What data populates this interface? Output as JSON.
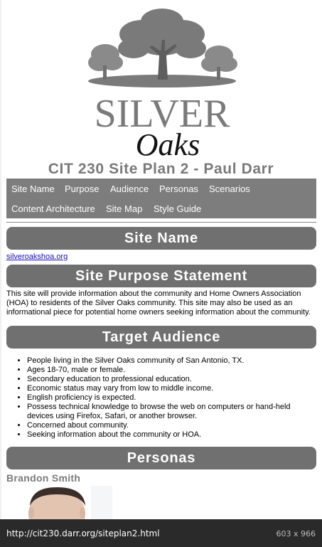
{
  "logo": {
    "line1": "SILVER",
    "line2": "Oaks"
  },
  "page_title": "CIT 230 Site Plan 2 - Paul Darr",
  "nav": {
    "items": [
      {
        "label": "Site Name"
      },
      {
        "label": "Purpose"
      },
      {
        "label": "Audience"
      },
      {
        "label": "Personas"
      },
      {
        "label": "Scenarios"
      },
      {
        "label": "Content Architecture"
      },
      {
        "label": "Site Map"
      },
      {
        "label": "Style Guide"
      }
    ]
  },
  "sections": {
    "site_name": {
      "heading": "Site Name",
      "link": "silveroakshoa.org"
    },
    "purpose": {
      "heading": "Site Purpose Statement",
      "text": "This site will provide information about the community and Home Owners Association (HOA) to residents of the Silver Oaks community. This site may also be used as an informational piece for potential home owners seeking information about the community."
    },
    "audience": {
      "heading": "Target Audience",
      "items": [
        "People living in the Silver Oaks community of San Antonio, TX.",
        "Ages 18-70, male or female.",
        "Secondary education to professional education.",
        "Economic status may vary from low to middle income.",
        "English proficiency is expected.",
        "Possess technical knowledge to browse the web on computers or hand-held devices using Firefox, Safari, or another browser.",
        "Concerned about community.",
        "Seeking information about the community or HOA."
      ]
    },
    "personas": {
      "heading": "Personas",
      "first_name": "Brandon Smith"
    }
  },
  "statusbar": {
    "url": "http://cit230.darr.org/siteplan2.html",
    "size": "603 x 966"
  },
  "colors": {
    "header_bg": "#707070",
    "nav_bg": "#7d7d7d",
    "title_gray": "#7a7a7a",
    "status_bg": "#2a2a2a"
  }
}
